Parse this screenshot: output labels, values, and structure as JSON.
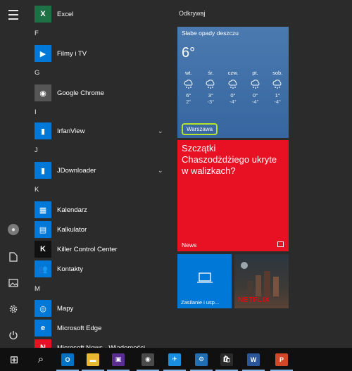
{
  "rail": {
    "icons": [
      "menu-icon",
      "user-icon",
      "documents-icon",
      "pictures-icon",
      "settings-icon",
      "power-icon"
    ]
  },
  "applist": {
    "items": [
      {
        "type": "app",
        "label": "Excel",
        "color": "#1e7145",
        "glyph": "X"
      },
      {
        "type": "letter",
        "label": "F"
      },
      {
        "type": "app",
        "label": "Filmy i TV",
        "color": "#0078d7",
        "glyph": "▶"
      },
      {
        "type": "letter",
        "label": "G"
      },
      {
        "type": "app",
        "label": "Google Chrome",
        "color": "#555555",
        "glyph": "◉"
      },
      {
        "type": "letter",
        "label": "I"
      },
      {
        "type": "app",
        "label": "IrfanView",
        "color": "#0078d7",
        "glyph": "▮",
        "chevron": "⌄"
      },
      {
        "type": "letter",
        "label": "J"
      },
      {
        "type": "app",
        "label": "JDownloader",
        "color": "#0078d7",
        "glyph": "▮",
        "chevron": "⌄"
      },
      {
        "type": "letter",
        "label": "K"
      },
      {
        "type": "app",
        "label": "Kalendarz",
        "color": "#0078d7",
        "glyph": "▦"
      },
      {
        "type": "app",
        "label": "Kalkulator",
        "color": "#0078d7",
        "glyph": "▤"
      },
      {
        "type": "app",
        "label": "Killer Control Center",
        "color": "#111111",
        "glyph": "K"
      },
      {
        "type": "app",
        "label": "Kontakty",
        "color": "#0078d7",
        "glyph": "👥"
      },
      {
        "type": "letter",
        "label": "M"
      },
      {
        "type": "app",
        "label": "Mapy",
        "color": "#0078d7",
        "glyph": "◎"
      },
      {
        "type": "app",
        "label": "Microsoft Edge",
        "color": "#0078d7",
        "glyph": "e"
      },
      {
        "type": "app",
        "label": "Microsoft News - Wiadomości",
        "color": "#e81123",
        "glyph": "N"
      }
    ]
  },
  "tiles": {
    "group_title": "Odkrywaj",
    "weather": {
      "condition": "Słabe opady deszczu",
      "temperature": "6°",
      "city": "Warszawa",
      "days": [
        {
          "name": "wt.",
          "hi": "6°",
          "lo": "2°"
        },
        {
          "name": "śr.",
          "hi": "3°",
          "lo": "-3°"
        },
        {
          "name": "czw.",
          "hi": "0°",
          "lo": "-4°"
        },
        {
          "name": "pt.",
          "hi": "0°",
          "lo": "-4°"
        },
        {
          "name": "sob.",
          "hi": "1°",
          "lo": "-4°"
        }
      ]
    },
    "news": {
      "headline": "Szczątki Chaszodżdżiego ukryte w walizkach?",
      "label": "News"
    },
    "power": {
      "label": "Zasilanie i usp..."
    },
    "netflix": {
      "label": "NETFLIX"
    }
  },
  "taskbar": {
    "items": [
      {
        "name": "start-button",
        "glyph": "⊞",
        "color": "#101010"
      },
      {
        "name": "search-button",
        "glyph": "⌕",
        "color": "#101010"
      },
      {
        "name": "taskbar-outlook",
        "glyph": "O",
        "color": "#0072c6"
      },
      {
        "name": "taskbar-file-explorer",
        "glyph": "▬",
        "color": "#e8b830"
      },
      {
        "name": "taskbar-save-app",
        "glyph": "▣",
        "color": "#5c2d91"
      },
      {
        "name": "taskbar-chrome",
        "glyph": "◉",
        "color": "#4a4a4a"
      },
      {
        "name": "taskbar-app-blue",
        "glyph": "✈",
        "color": "#1a8fe0"
      },
      {
        "name": "taskbar-settings-app",
        "glyph": "⚙",
        "color": "#1e6fb5"
      },
      {
        "name": "taskbar-store",
        "glyph": "🛍",
        "color": "#2a2a2a"
      },
      {
        "name": "taskbar-word",
        "glyph": "W",
        "color": "#2b579a"
      },
      {
        "name": "taskbar-powerpoint",
        "glyph": "P",
        "color": "#d24726"
      }
    ]
  }
}
